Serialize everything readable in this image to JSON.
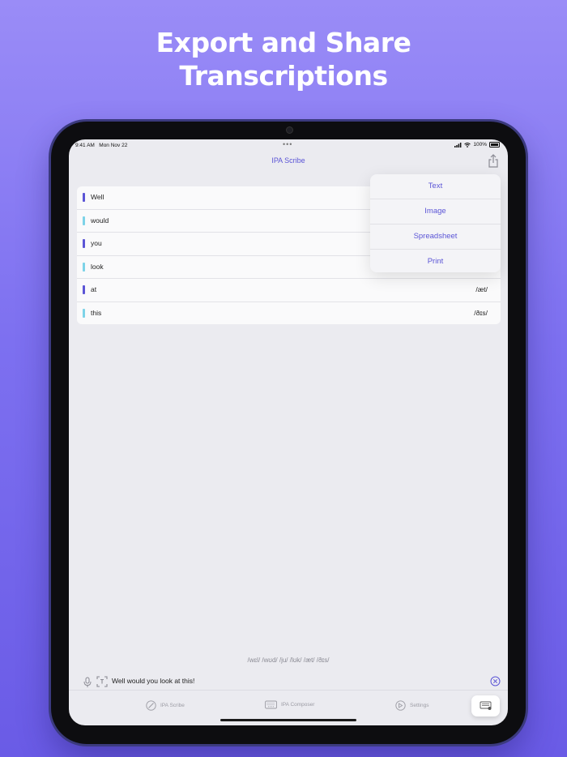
{
  "headline": {
    "line1": "Export and Share",
    "line2": "Transcriptions"
  },
  "status": {
    "time": "9:41 AM",
    "date": "Mon Nov 22",
    "dots": "•••",
    "battery": "100%"
  },
  "nav": {
    "title": "IPA Scribe",
    "share_icon": "share-icon"
  },
  "words": [
    {
      "word": "Well",
      "ipa": "",
      "color": "#5b55d6"
    },
    {
      "word": "would",
      "ipa": "",
      "color": "#7dd3e8"
    },
    {
      "word": "you",
      "ipa": "",
      "color": "#5b55d6"
    },
    {
      "word": "look",
      "ipa": "",
      "color": "#7dd3e8"
    },
    {
      "word": "at",
      "ipa": "/æt/",
      "color": "#5b55d6"
    },
    {
      "word": "this",
      "ipa": "/ðɪs/",
      "color": "#7dd3e8"
    }
  ],
  "export_menu": {
    "items": [
      "Text",
      "Image",
      "Spreadsheet",
      "Print"
    ]
  },
  "transcript": "/wɛl/ /wʊd/ /ju/ /lʊk/ /æt/ /ðɪs/",
  "input": {
    "value": "Well would you look at this!"
  },
  "tabs": [
    {
      "label": "IPA Scribe",
      "icon": "pencil-icon"
    },
    {
      "label": "IPA Composer",
      "icon": "keyboard-icon"
    },
    {
      "label": "Settings",
      "icon": "settings-icon"
    }
  ],
  "colors": {
    "accent": "#5b55d6",
    "alt": "#7dd3e8",
    "background_top": "#9a8cf7",
    "background_bottom": "#6a5be6"
  }
}
